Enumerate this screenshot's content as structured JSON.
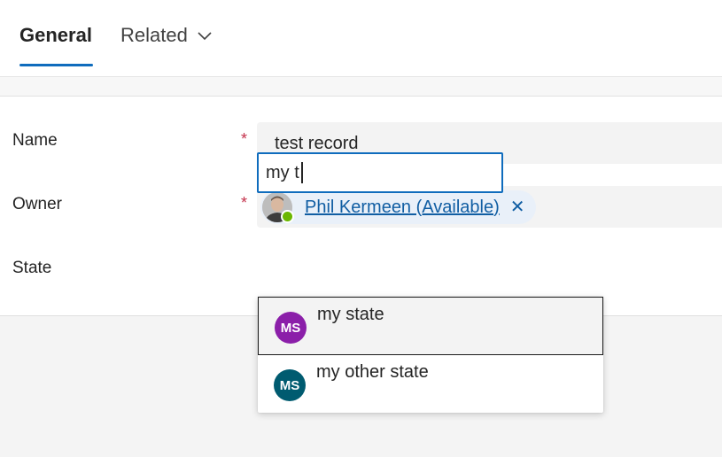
{
  "tabs": {
    "general": "General",
    "related": "Related"
  },
  "form": {
    "name": {
      "label": "Name",
      "required": "*",
      "value": "test record"
    },
    "owner": {
      "label": "Owner",
      "required": "*",
      "value": "Phil Kermeen (Available)",
      "presence": "available"
    },
    "state": {
      "label": "State",
      "value": "my t"
    }
  },
  "dropdown": {
    "options": [
      {
        "initials": "MS",
        "label": "my state",
        "color": "#8b1fa9"
      },
      {
        "initials": "MS",
        "label": "my other state",
        "color": "#005b70"
      }
    ]
  },
  "colors": {
    "accent": "#0f6cbd",
    "required": "#c4314b",
    "link": "#115ea3"
  }
}
